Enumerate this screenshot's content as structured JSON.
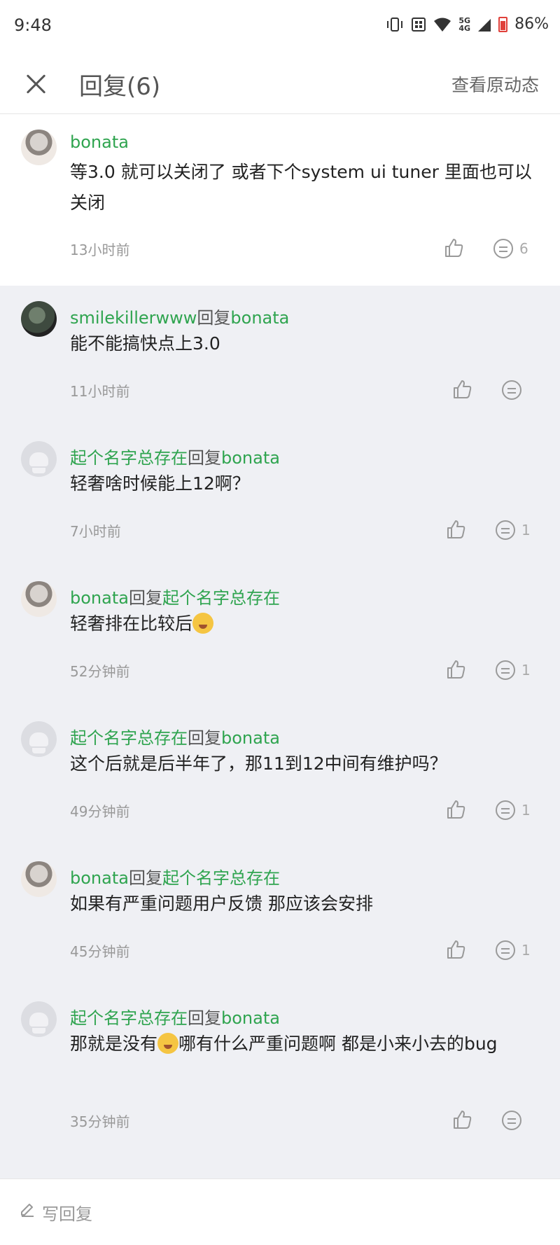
{
  "status_bar": {
    "time": "9:48",
    "network_top": "5G",
    "network_bottom": "4G",
    "battery": "86%"
  },
  "header": {
    "title": "回复(6)",
    "view_original": "查看原动态"
  },
  "main_comment": {
    "author": "bonata",
    "text": "等3.0 就可以关闭了 或者下个system ui tuner 里面也可以关闭",
    "time": "13小时前",
    "reply_count": "6"
  },
  "replies": [
    {
      "author": "smilekillerwww",
      "reply_word": "回复",
      "target": "bonata",
      "text": "能不能搞快点上3.0",
      "time": "11小时前",
      "reply_count": "",
      "avatar": "smile"
    },
    {
      "author": "起个名字总存在",
      "reply_word": "回复",
      "target": "bonata",
      "text": "轻奢啥时候能上12啊？",
      "time": "7小时前",
      "reply_count": "1",
      "avatar": "default"
    },
    {
      "author": "bonata",
      "reply_word": "回复",
      "target": "起个名字总存在",
      "text": "轻奢排在比较后",
      "time": "52分钟前",
      "reply_count": "1",
      "avatar": "bonata",
      "emoji": "dizzy-face-emoji"
    },
    {
      "author": "起个名字总存在",
      "reply_word": "回复",
      "target": "bonata",
      "text": "这个后就是后半年了，那11到12中间有维护吗？",
      "time": "49分钟前",
      "reply_count": "1",
      "avatar": "default"
    },
    {
      "author": "bonata",
      "reply_word": "回复",
      "target": "起个名字总存在",
      "text": "如果有严重问题用户反馈 那应该会安排",
      "time": "45分钟前",
      "reply_count": "1",
      "avatar": "bonata"
    },
    {
      "author": "起个名字总存在",
      "reply_word": "回复",
      "target": "bonata",
      "text_before": "那就是没有",
      "text_after": "哪有什么严重问题啊 都是小来小去的bug",
      "time": "35分钟前",
      "reply_count": "",
      "avatar": "default",
      "emoji": "shocked-face-emoji"
    }
  ],
  "bottom_bar": {
    "write_reply": "写回复"
  }
}
